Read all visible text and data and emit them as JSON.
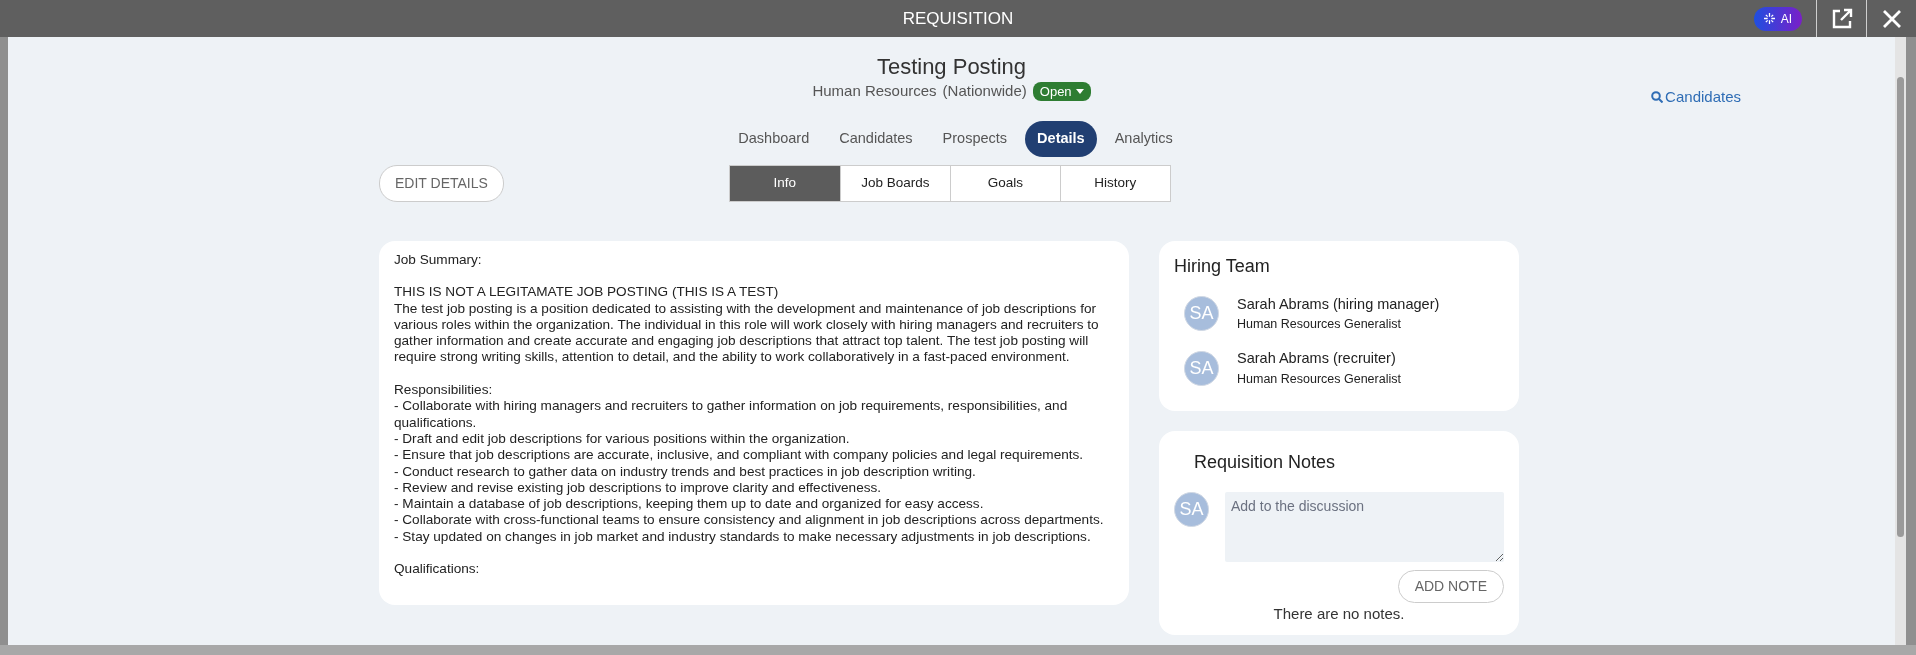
{
  "window": {
    "title": "REQUISITION",
    "ai_label": "AI"
  },
  "header": {
    "title": "Testing Posting",
    "department": "Human Resources",
    "location": "(Nationwide)",
    "status": "Open",
    "candidates_link": "Candidates"
  },
  "tabs": [
    {
      "label": "Dashboard",
      "selected": false
    },
    {
      "label": "Candidates",
      "selected": false
    },
    {
      "label": "Prospects",
      "selected": false
    },
    {
      "label": "Details",
      "selected": true
    },
    {
      "label": "Analytics",
      "selected": false
    }
  ],
  "edit_button": "EDIT DETAILS",
  "subtabs": [
    {
      "label": "Info",
      "selected": true
    },
    {
      "label": "Job Boards",
      "selected": false
    },
    {
      "label": "Goals",
      "selected": false
    },
    {
      "label": "History",
      "selected": false
    }
  ],
  "description": [
    [
      "Job Summary:"
    ],
    [
      "THIS IS NOT A LEGITAMATE JOB POSTING (THIS IS A TEST)",
      "The test job posting is a position dedicated to assisting with the development and maintenance of job descriptions for various roles within the organization. The individual in this role will work closely with hiring managers and recruiters to gather information and create accurate and engaging job descriptions that attract top talent. The test job posting will require strong writing skills, attention to detail, and the ability to work collaboratively in a fast-paced environment."
    ],
    [
      "Responsibilities:",
      "- Collaborate with hiring managers and recruiters to gather information on job requirements, responsibilities, and qualifications.",
      "- Draft and edit job descriptions for various positions within the organization.",
      "- Ensure that job descriptions are accurate, inclusive, and compliant with company policies and legal requirements.",
      "- Conduct research to gather data on industry trends and best practices in job description writing.",
      "- Review and revise existing job descriptions to improve clarity and effectiveness.",
      "- Maintain a database of job descriptions, keeping them up to date and organized for easy access.",
      "- Collaborate with cross-functional teams to ensure consistency and alignment in job descriptions across departments.",
      "- Stay updated on changes in job market and industry standards to make necessary adjustments in job descriptions."
    ],
    [
      "Qualifications:"
    ]
  ],
  "hiring_team": {
    "title": "Hiring Team",
    "members": [
      {
        "initials": "SA",
        "name": "Sarah Abrams (hiring manager)",
        "role": "Human Resources Generalist"
      },
      {
        "initials": "SA",
        "name": "Sarah Abrams (recruiter)",
        "role": "Human Resources Generalist"
      }
    ]
  },
  "notes": {
    "title": "Requisition Notes",
    "initials": "SA",
    "placeholder": "Add to the discussion",
    "button": "ADD NOTE",
    "empty": "There are no notes."
  }
}
